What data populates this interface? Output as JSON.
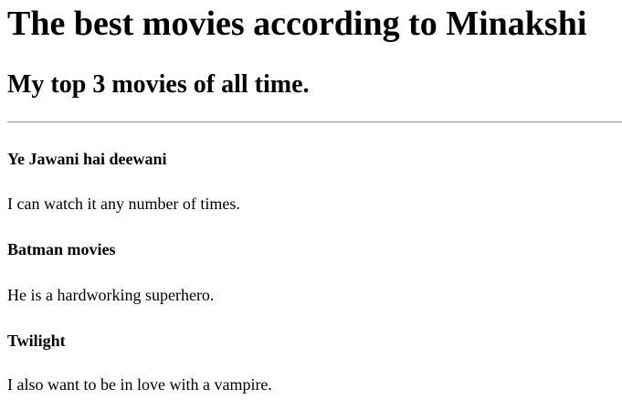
{
  "page": {
    "title": "The best movies according to Minakshi",
    "subtitle": "My top 3 movies of all time."
  },
  "movies": [
    {
      "title": "Ye Jawani hai deewani",
      "note": "I can watch it any number of times."
    },
    {
      "title": "Batman movies",
      "note": "He is a hardworking superhero."
    },
    {
      "title": "Twilight",
      "note": "I also want to be in love with a vampire."
    }
  ],
  "colors": {
    "background": "#ffffff",
    "text": "#000000",
    "divider": "#9a9a9a"
  }
}
